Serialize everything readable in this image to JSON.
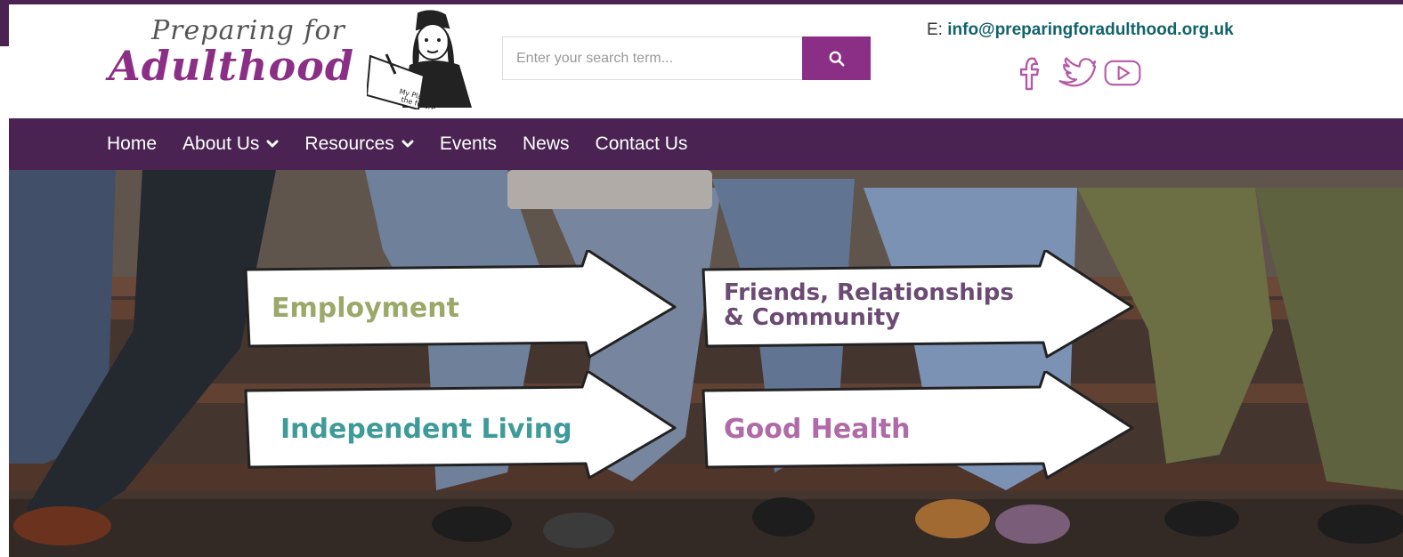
{
  "brand": {
    "logo_line1": "Preparing for",
    "logo_line2": "Adulthood"
  },
  "search": {
    "placeholder": "Enter your search term...",
    "value": ""
  },
  "contact": {
    "email_prefix": "E:",
    "email": "info@preparingforadulthood.org.uk"
  },
  "socials": [
    {
      "icon": "facebook-icon"
    },
    {
      "icon": "twitter-icon"
    },
    {
      "icon": "youtube-icon"
    }
  ],
  "nav": {
    "items": [
      {
        "label": "Home",
        "dropdown": false
      },
      {
        "label": "About Us",
        "dropdown": true
      },
      {
        "label": "Resources",
        "dropdown": true
      },
      {
        "label": "Events",
        "dropdown": false
      },
      {
        "label": "News",
        "dropdown": false
      },
      {
        "label": "Contact Us",
        "dropdown": false
      }
    ]
  },
  "hero": {
    "arrows": [
      {
        "label": "Employment",
        "color": "#9aa86a"
      },
      {
        "label_line1": "Friends, Relationships",
        "label_line2": "& Community",
        "color": "#6b4b73"
      },
      {
        "label": "Independent Living",
        "color": "#3f9a9a"
      },
      {
        "label": "Good Health",
        "color": "#b06aa8"
      }
    ]
  },
  "colors": {
    "brand_purple": "#8b2f86",
    "nav_bg": "#4a2352",
    "email_teal": "#12636a"
  }
}
